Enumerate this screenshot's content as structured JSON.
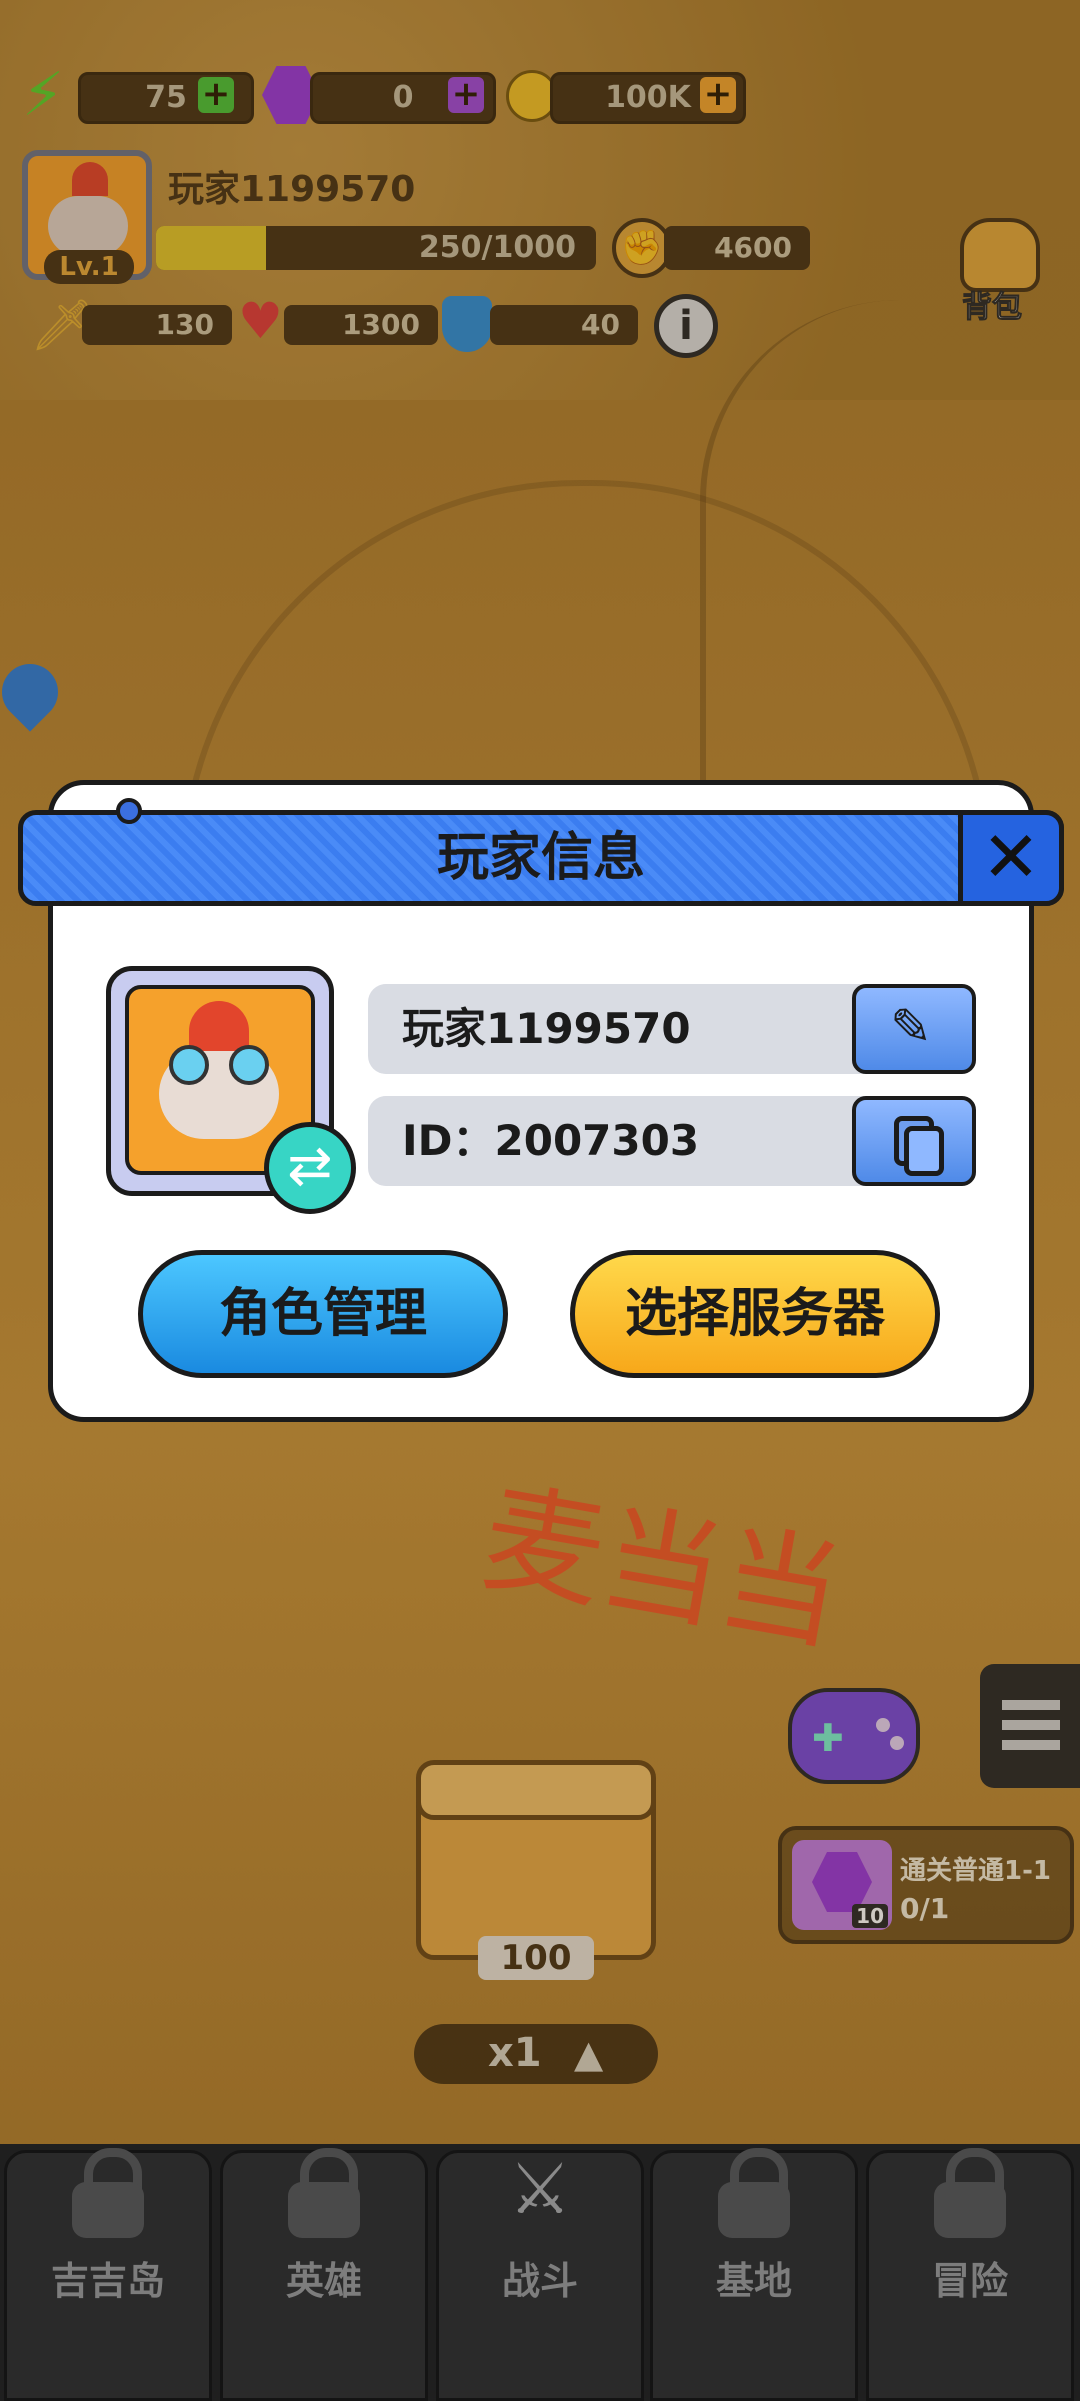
{
  "hud": {
    "energy": "75",
    "gems": "0",
    "coins": "100K",
    "player_name": "玩家1199570",
    "level": "Lv.1",
    "xp_text": "250/1000",
    "xp_fraction": 0.25,
    "power": "4600",
    "attack": "130",
    "health": "1300",
    "defense": "40",
    "backpack_label": "背包"
  },
  "modal": {
    "title": "玩家信息",
    "name_value": "玩家1199570",
    "id_value": "ID：2007303",
    "role_button": "角色管理",
    "server_button": "选择服务器"
  },
  "watermark": "麦当当",
  "side": {
    "quest_title": "通关普通1-1",
    "quest_progress": "0/1",
    "quest_reward_count": "10"
  },
  "chest": {
    "count": "100",
    "multiplier": "x1"
  },
  "nav": {
    "tabs": [
      "吉吉岛",
      "英雄",
      "战斗",
      "基地",
      "冒险"
    ]
  },
  "colors": {
    "accent_blue": "#3b7df0",
    "button_blue": "#1aa6f0",
    "button_yellow": "#ffc21a",
    "watermark": "#f25a2a"
  }
}
